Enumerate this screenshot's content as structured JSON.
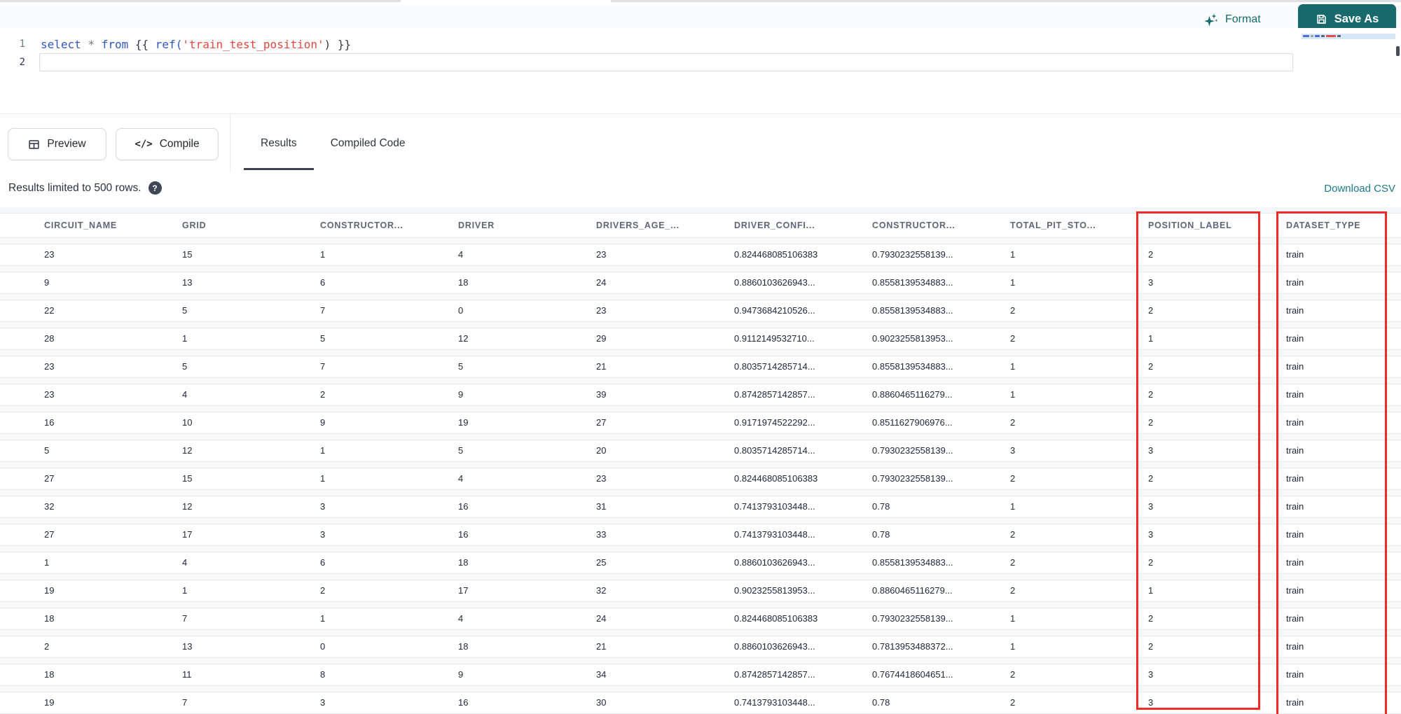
{
  "colors": {
    "accent": "#17696c",
    "link": "#1d7a8c",
    "highlight": "#ee2b24"
  },
  "top_toolbar": {
    "format_label": "Format",
    "format_icon": "sparkles-icon",
    "save_as_label": "Save As",
    "save_as_icon": "floppy-disk-icon"
  },
  "editor": {
    "lines": [
      {
        "number": "1",
        "active": false,
        "tokens": [
          {
            "t": "select",
            "c": "kw"
          },
          {
            "t": " ",
            "c": "pl"
          },
          {
            "t": "*",
            "c": "op"
          },
          {
            "t": " ",
            "c": "pl"
          },
          {
            "t": "from",
            "c": "kw"
          },
          {
            "t": " ",
            "c": "pl"
          },
          {
            "t": "{{ ",
            "c": "br"
          },
          {
            "t": "ref(",
            "c": "fn"
          },
          {
            "t": "'train_test_position'",
            "c": "str"
          },
          {
            "t": ")",
            "c": "br"
          },
          {
            "t": " }}",
            "c": "br"
          }
        ]
      },
      {
        "number": "2",
        "active": true,
        "tokens": []
      }
    ]
  },
  "results_toolbar": {
    "preview_label": "Preview",
    "preview_icon": "table-grid-icon",
    "compile_label": "Compile",
    "compile_icon": "code-icon",
    "compile_glyph": "</>",
    "tabs": [
      {
        "label": "Results",
        "active": true
      },
      {
        "label": "Compiled Code",
        "active": false
      }
    ]
  },
  "results_meta": {
    "limit_text": "Results limited to 500 rows.",
    "help_icon": "question-circle-icon",
    "help_glyph": "?",
    "download_label": "Download CSV"
  },
  "table": {
    "columns": [
      "CIRCUIT_NAME",
      "GRID",
      "CONSTRUCTOR...",
      "DRIVER",
      "DRIVERS_AGE_...",
      "DRIVER_CONFI...",
      "CONSTRUCTOR...",
      "TOTAL_PIT_STO...",
      "POSITION_LABEL",
      "DATASET_TYPE"
    ],
    "highlighted_columns": [
      "POSITION_LABEL",
      "DATASET_TYPE"
    ],
    "rows": [
      [
        "23",
        "15",
        "1",
        "4",
        "23",
        "0.824468085106383",
        "0.7930232558139...",
        "1",
        "2",
        "train"
      ],
      [
        "9",
        "13",
        "6",
        "18",
        "24",
        "0.8860103626943...",
        "0.8558139534883...",
        "1",
        "3",
        "train"
      ],
      [
        "22",
        "5",
        "7",
        "0",
        "23",
        "0.9473684210526...",
        "0.8558139534883...",
        "2",
        "2",
        "train"
      ],
      [
        "28",
        "1",
        "5",
        "12",
        "29",
        "0.9112149532710...",
        "0.9023255813953...",
        "2",
        "1",
        "train"
      ],
      [
        "23",
        "5",
        "7",
        "5",
        "21",
        "0.8035714285714...",
        "0.8558139534883...",
        "1",
        "2",
        "train"
      ],
      [
        "23",
        "4",
        "2",
        "9",
        "39",
        "0.8742857142857...",
        "0.8860465116279...",
        "1",
        "2",
        "train"
      ],
      [
        "16",
        "10",
        "9",
        "19",
        "27",
        "0.9171974522292...",
        "0.8511627906976...",
        "2",
        "2",
        "train"
      ],
      [
        "5",
        "12",
        "1",
        "5",
        "20",
        "0.8035714285714...",
        "0.7930232558139...",
        "3",
        "3",
        "train"
      ],
      [
        "27",
        "15",
        "1",
        "4",
        "23",
        "0.824468085106383",
        "0.7930232558139...",
        "2",
        "2",
        "train"
      ],
      [
        "32",
        "12",
        "3",
        "16",
        "31",
        "0.7413793103448...",
        "0.78",
        "1",
        "3",
        "train"
      ],
      [
        "27",
        "17",
        "3",
        "16",
        "33",
        "0.7413793103448...",
        "0.78",
        "2",
        "3",
        "train"
      ],
      [
        "1",
        "4",
        "6",
        "18",
        "25",
        "0.8860103626943...",
        "0.8558139534883...",
        "2",
        "2",
        "train"
      ],
      [
        "19",
        "1",
        "2",
        "17",
        "32",
        "0.9023255813953...",
        "0.8860465116279...",
        "2",
        "1",
        "train"
      ],
      [
        "18",
        "7",
        "1",
        "4",
        "24",
        "0.824468085106383",
        "0.7930232558139...",
        "1",
        "2",
        "train"
      ],
      [
        "2",
        "13",
        "0",
        "18",
        "21",
        "0.8860103626943...",
        "0.7813953488372...",
        "1",
        "2",
        "train"
      ],
      [
        "18",
        "11",
        "8",
        "9",
        "34",
        "0.8742857142857...",
        "0.7674418604651...",
        "2",
        "3",
        "train"
      ],
      [
        "19",
        "7",
        "3",
        "16",
        "30",
        "0.7413793103448...",
        "0.78",
        "2",
        "3",
        "train"
      ]
    ]
  }
}
